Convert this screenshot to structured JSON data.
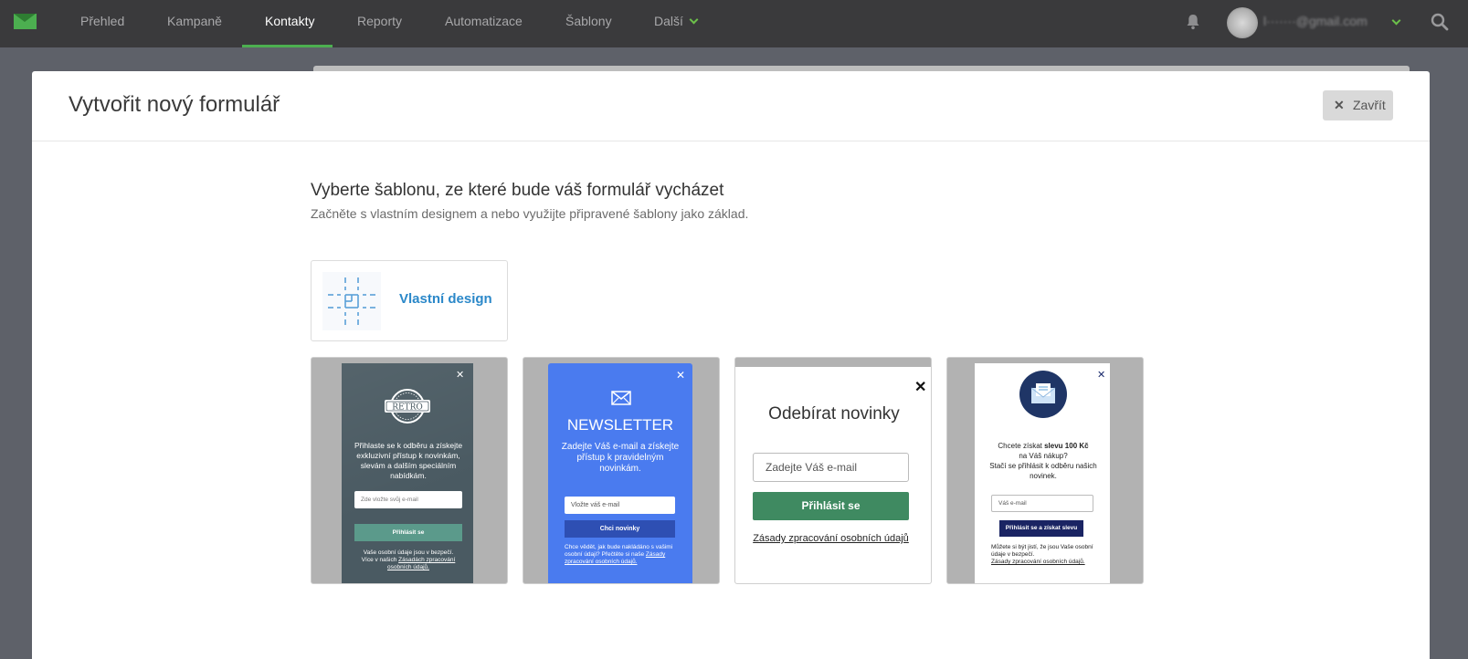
{
  "nav": {
    "items": [
      "Přehled",
      "Kampaně",
      "Kontakty",
      "Reporty",
      "Automatizace",
      "Šablony",
      "Další"
    ],
    "active": "Kontakty",
    "user_email": "l·······@gmail.com",
    "accent": "#4caf50"
  },
  "modal": {
    "title": "Vytvořit nový formulář",
    "close_label": "Zavřít",
    "heading": "Vyberte šablonu, ze které bude váš formulář vycházet",
    "subheading": "Začněte s vlastním designem a nebo využijte připravené šablony jako základ.",
    "custom_design_label": "Vlastní design"
  },
  "templates": {
    "retro": {
      "badge": "RETRO",
      "text": "Přihlaste se k odběru a získejte exkluzivní přístup k novinkám, slevám a dalším speciálním nabídkám.",
      "input_placeholder": "Zde vložte svůj e-mail",
      "button": "Přihlásit se",
      "footer_line1": "Vaše osobní údaje jsou v bezpečí.",
      "footer_line2": "Více v našich",
      "footer_link": "Zásadách zpracování osobních údajů."
    },
    "newsletter": {
      "title": "NEWSLETTER",
      "text": "Zadejte Váš e-mail a získejte přístup k pravidelným novinkám.",
      "input_placeholder": "Vložte váš e-mail",
      "button": "Chci novinky",
      "footer_text": "Chce vědět, jak bude nakládáno s vašimi osobní údaji? Přečtěte si naše",
      "footer_link": "Zásady zpracování osobních údajů."
    },
    "odebirat": {
      "title": "Odebírat novinky",
      "input_placeholder": "Zadejte Váš e-mail",
      "button": "Přihlásit se",
      "link": "Zásady zpracování osobních údajů"
    },
    "sleva": {
      "text_pre": "Chcete získat",
      "text_bold": "slevu 100 Kč",
      "text_post": "na Váš nákup?",
      "text2": "Stačí se přihlásit k odběru našich novinek.",
      "input_placeholder": "Váš e-mail",
      "button": "Přihlásit se a získat slevu",
      "footer_text": "Můžete si být jistí, že jsou Vaše osobní údaje v bezpečí.",
      "footer_link": "Zásady zpracování osobních údajů."
    }
  }
}
